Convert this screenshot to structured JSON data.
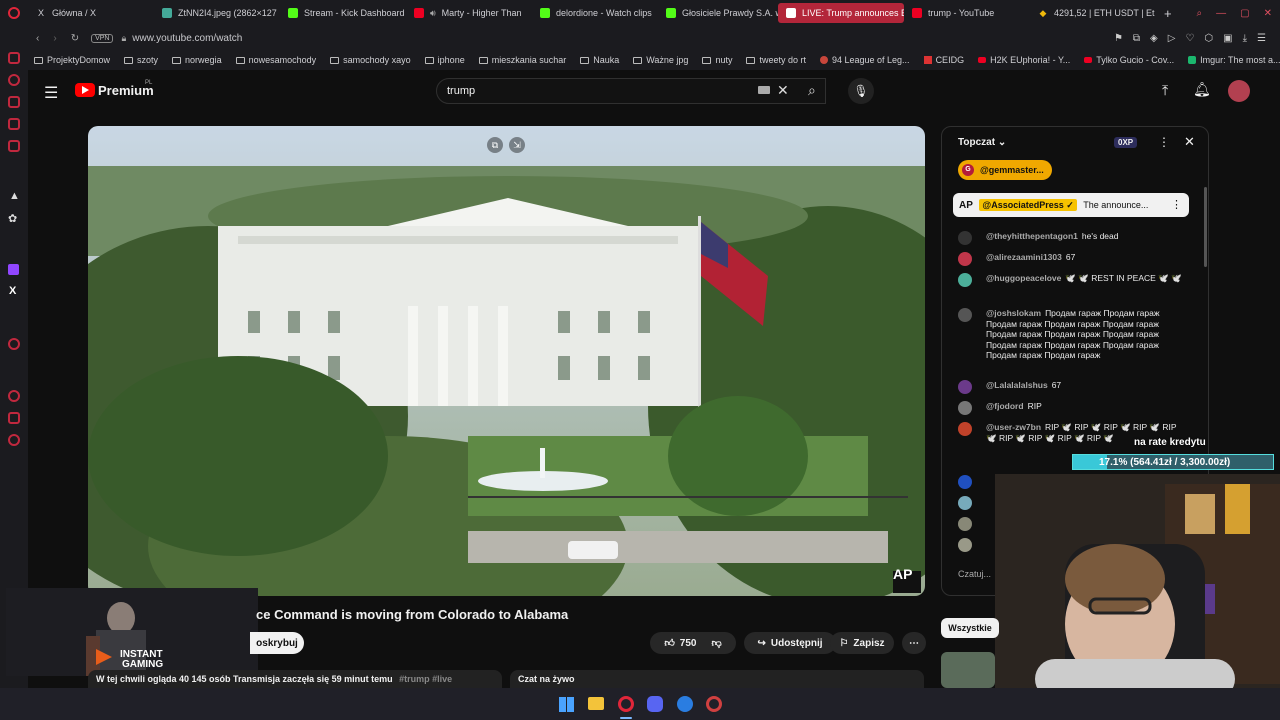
{
  "tabs": [
    {
      "label": "Główna / X",
      "icon": "x-icon"
    },
    {
      "label": "ZtNN2I4.jpeg (2862×127",
      "icon": "image-icon"
    },
    {
      "label": "Stream - Kick Dashboard",
      "icon": "kick-icon"
    },
    {
      "label": "Marty - Higher Than",
      "icon": "youtube-icon"
    },
    {
      "label": "delordione - Watch clips",
      "icon": "kick-icon"
    },
    {
      "label": "Głosiciele Prawdy S.A. w",
      "icon": "kick-icon"
    },
    {
      "label": "LIVE: Trump announces E",
      "icon": "youtube-icon"
    },
    {
      "label": "trump - YouTube",
      "icon": "youtube-icon"
    },
    {
      "label": "4291,52 | ETH USDT | Et",
      "icon": "binance-icon"
    }
  ],
  "address": {
    "vpn": "VPN",
    "url": "www.youtube.com/watch"
  },
  "bookmarks": [
    "ProjektyDomow",
    "szoty",
    "norwegia",
    "nowesamochody",
    "samochody xayo",
    "iphone",
    "mieszkania suchar",
    "Nauka",
    "Ważne jpg",
    "nuty",
    "tweety do rt",
    "94 League of Leg...",
    "CEIDG",
    "H2K EUphoria! - Y...",
    "Tylko Gucio - Cov...",
    "Imgur: The most a..."
  ],
  "youtube": {
    "logo": "Premium",
    "logo_sup": "PL",
    "search_value": "trump",
    "video_title": "ce Command is moving from Colorado to Alabama",
    "subscribe_label": "oskrybuj",
    "likes": "750",
    "share_label": "Udostępnij",
    "save_label": "Zapisz",
    "viewers_line": "W tej chwili ogląda 40 145 osób  Transmisja zaczęła się 59 minut temu",
    "hashtags": "#trump #live",
    "live_chat_label": "Czat na żywo",
    "filter_all": "Wszystkie",
    "watermark": "AP"
  },
  "chat": {
    "header": "Topczat",
    "xp": "0XP",
    "pinned_user": "@gemmaster...",
    "highlight": {
      "author": "@AssociatedPress ✓",
      "text": "The announce..."
    },
    "messages": [
      {
        "author": "@theyhitthepentagon1",
        "text": "he's dead",
        "color": "#333"
      },
      {
        "author": "@alirezaamini1303",
        "text": "67",
        "color": "#c0364a",
        "avatar": "a"
      },
      {
        "author": "@huggopeacelove",
        "text": "🕊️ 🕊️ REST IN PEACE 🕊️ 🕊️",
        "color": "#4caf9a"
      },
      {
        "author": "@joshslokam",
        "text": "Продам гараж Продам гараж Продам гараж Продам гараж Продам гараж Продам гараж Продам гараж Продам гараж Продам гараж Продам гараж Продам гараж Продам гараж Продам гараж",
        "color": "#555"
      },
      {
        "author": "@Lalalalalshus",
        "text": "67",
        "color": "#6b3a8a"
      },
      {
        "author": "@fjodord",
        "text": "RIP",
        "color": "#777"
      },
      {
        "author": "@user-zw7bn",
        "text": "RIP 🕊️ RIP 🕊️ RIP 🕊️ RIP 🕊️ RIP 🕊️ RIP 🕊️ RIP 🕊️ RIP 🕊️ RIP 🕊️",
        "color": "#c0422a",
        "avatar": "s"
      }
    ],
    "input_placeholder": "Czatuj..."
  },
  "overlay": {
    "credit_label": "na rate kredytu",
    "credit_progress": "17.1% (564.41zł / 3,300.00zł)",
    "credit_fraction": 0.171,
    "ad_brand": "INSTANT",
    "ad_brand2": "GAMING"
  }
}
